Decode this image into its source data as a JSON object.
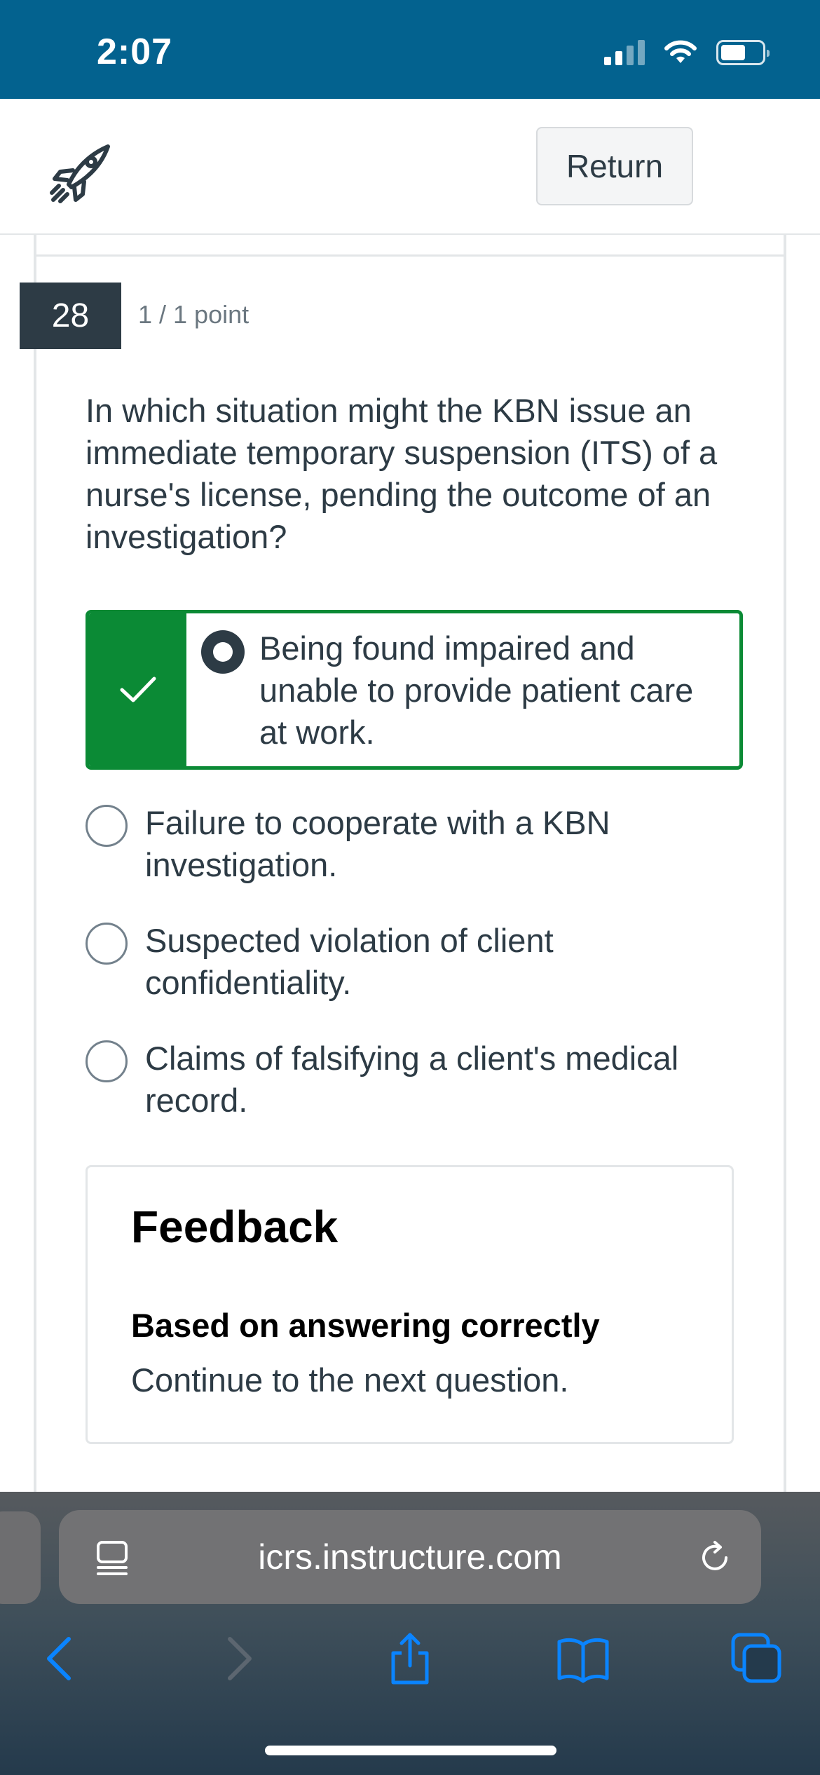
{
  "status_bar": {
    "time": "2:07"
  },
  "header": {
    "logo_icon": "rocket-icon",
    "return_label": "Return"
  },
  "question": {
    "number": "28",
    "points": "1 / 1 point",
    "text": "In which situation might the KBN issue an immediate temporary suspension (ITS) of a nurse's license, pending the outcome of an investigation?",
    "answers": [
      {
        "text": "Being found impaired and unable to provide patient care at work.",
        "selected": true,
        "correct": true
      },
      {
        "text": "Failure to cooperate with a KBN investigation.",
        "selected": false,
        "correct": false
      },
      {
        "text": "Suspected violation of client confidentiality.",
        "selected": false,
        "correct": false
      },
      {
        "text": "Claims of falsifying a client's medical record.",
        "selected": false,
        "correct": false
      }
    ]
  },
  "feedback": {
    "title": "Feedback",
    "subtitle": "Based on answering correctly",
    "text": "Continue to the next question."
  },
  "browser": {
    "url": "icrs.instructure.com"
  },
  "colors": {
    "status_bar": "#03628f",
    "correct_green": "#0b8a35",
    "question_number_bg": "#2d3b45",
    "browser_accent": "#0a84ff"
  }
}
